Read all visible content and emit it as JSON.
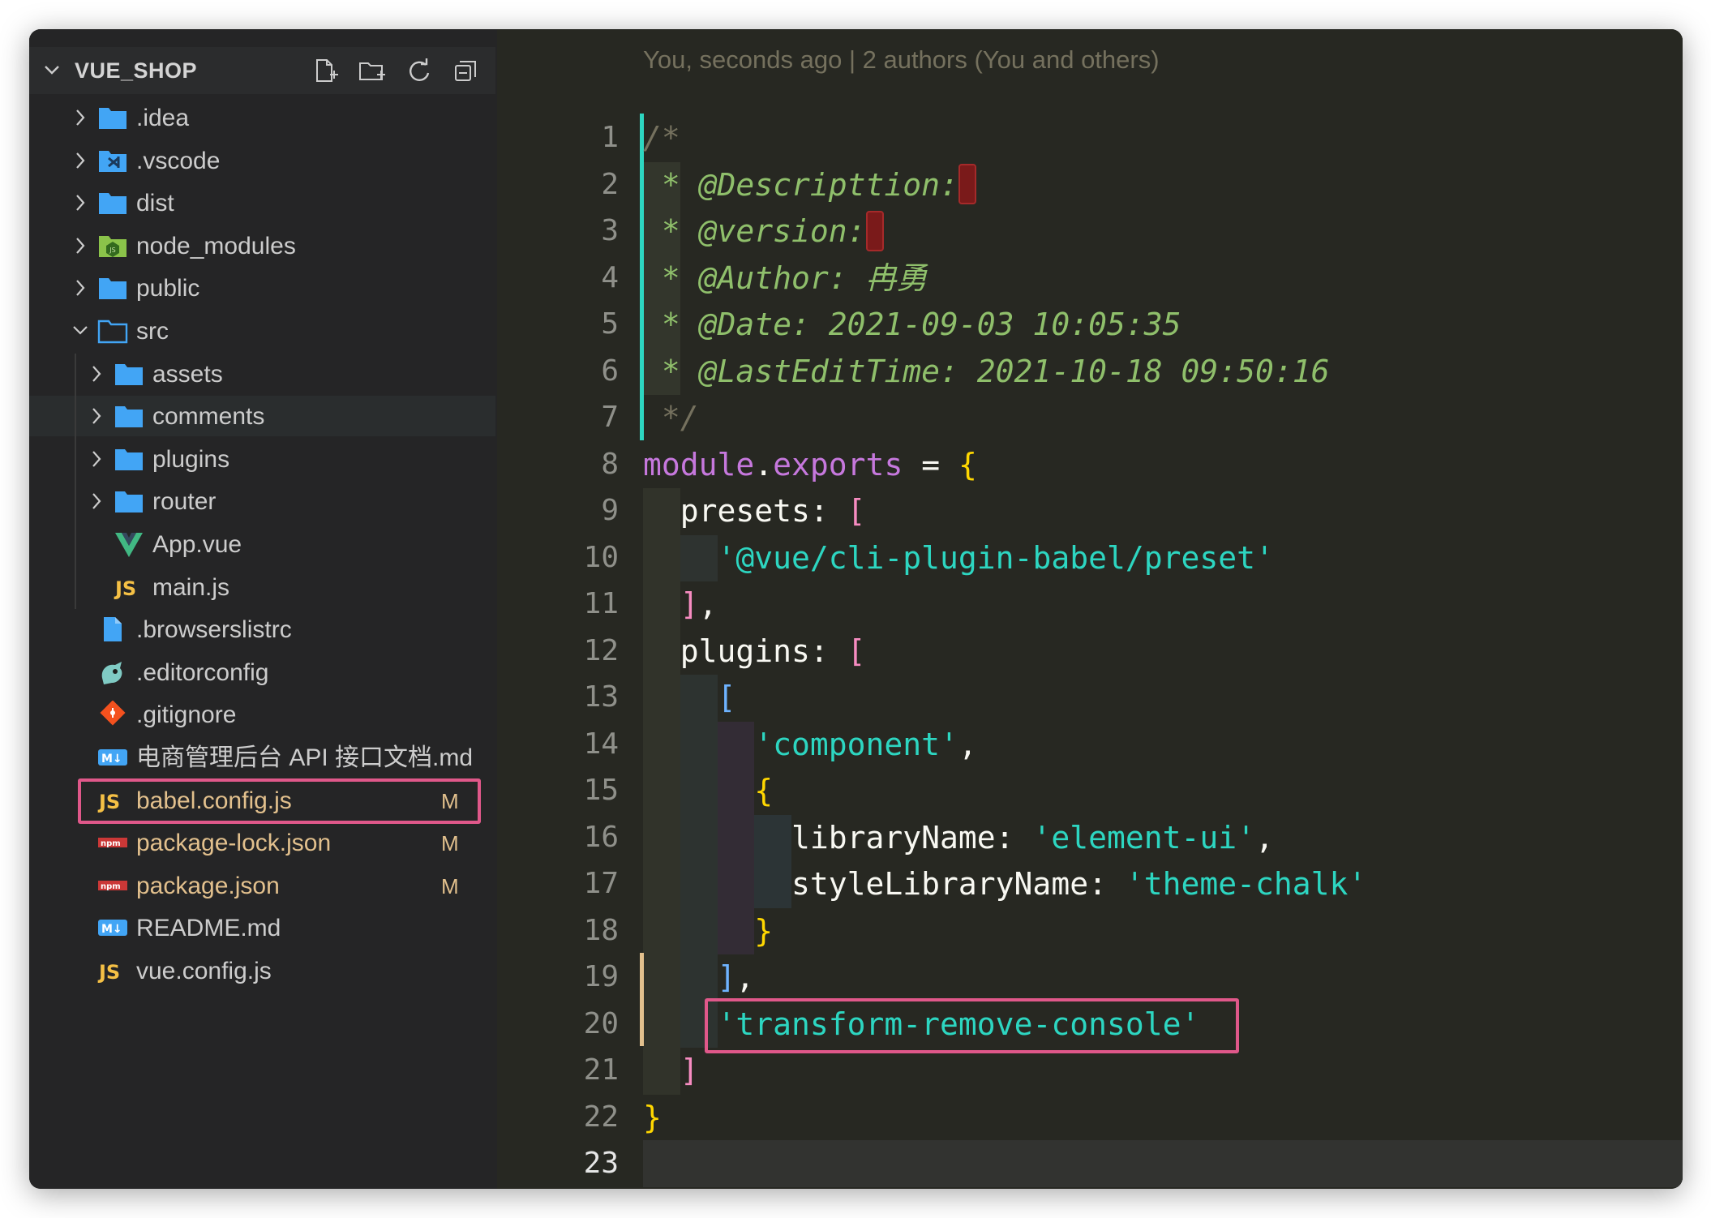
{
  "sidebar": {
    "project_name": "VUE_SHOP",
    "actions": [
      "new-file-icon",
      "new-folder-icon",
      "refresh-icon",
      "collapse-all-icon"
    ],
    "items": [
      {
        "label": ".idea",
        "type": "folder",
        "icon": "folder-icon",
        "depth": 0,
        "expanded": false
      },
      {
        "label": ".vscode",
        "type": "folder",
        "icon": "vscode-folder-icon",
        "depth": 0,
        "expanded": false
      },
      {
        "label": "dist",
        "type": "folder",
        "icon": "folder-icon",
        "depth": 0,
        "expanded": false
      },
      {
        "label": "node_modules",
        "type": "folder",
        "icon": "node-folder-icon",
        "depth": 0,
        "expanded": false
      },
      {
        "label": "public",
        "type": "folder",
        "icon": "folder-icon",
        "depth": 0,
        "expanded": false
      },
      {
        "label": "src",
        "type": "folder",
        "icon": "folder-open-icon",
        "depth": 0,
        "expanded": true
      },
      {
        "label": "assets",
        "type": "folder",
        "icon": "folder-icon",
        "depth": 1,
        "expanded": false
      },
      {
        "label": "comments",
        "type": "folder",
        "icon": "folder-icon",
        "depth": 1,
        "expanded": false,
        "hover": true
      },
      {
        "label": "plugins",
        "type": "folder",
        "icon": "folder-icon",
        "depth": 1,
        "expanded": false
      },
      {
        "label": "router",
        "type": "folder",
        "icon": "folder-icon",
        "depth": 1,
        "expanded": false
      },
      {
        "label": "App.vue",
        "type": "file",
        "icon": "vue-icon",
        "depth": 1
      },
      {
        "label": "main.js",
        "type": "file",
        "icon": "js-icon",
        "depth": 1
      },
      {
        "label": ".browserslistrc",
        "type": "file",
        "icon": "file-icon",
        "depth": 0
      },
      {
        "label": ".editorconfig",
        "type": "file",
        "icon": "editorconfig-icon",
        "depth": 0
      },
      {
        "label": ".gitignore",
        "type": "file",
        "icon": "git-icon",
        "depth": 0
      },
      {
        "label": "电商管理后台 API 接口文档.md",
        "type": "file",
        "icon": "markdown-icon",
        "depth": 0
      },
      {
        "label": "babel.config.js",
        "type": "file",
        "icon": "js-icon",
        "depth": 0,
        "badge": "M",
        "highlighted": true
      },
      {
        "label": "package-lock.json",
        "type": "file",
        "icon": "npm-icon",
        "depth": 0,
        "badge": "M"
      },
      {
        "label": "package.json",
        "type": "file",
        "icon": "npm-icon",
        "depth": 0,
        "badge": "M"
      },
      {
        "label": "README.md",
        "type": "file",
        "icon": "markdown-icon",
        "depth": 0
      },
      {
        "label": "vue.config.js",
        "type": "file",
        "icon": "js-icon",
        "depth": 0
      }
    ]
  },
  "editor": {
    "blame": "You, seconds ago | 2 authors (You and others)",
    "active_line": 23,
    "line_numbers": [
      "1",
      "2",
      "3",
      "4",
      "5",
      "6",
      "7",
      "8",
      "9",
      "10",
      "11",
      "12",
      "13",
      "14",
      "15",
      "16",
      "17",
      "18",
      "19",
      "20",
      "21",
      "22",
      "23"
    ],
    "lines": [
      {
        "tokens": [
          {
            "t": "/*",
            "c": "c-gray"
          }
        ]
      },
      {
        "tokens": [
          {
            "t": " * @Descripttion:",
            "c": "c-com"
          }
        ],
        "error": true
      },
      {
        "tokens": [
          {
            "t": " * @version:",
            "c": "c-com"
          }
        ],
        "error": true
      },
      {
        "tokens": [
          {
            "t": " * @Author: 冉勇",
            "c": "c-com"
          }
        ]
      },
      {
        "tokens": [
          {
            "t": " * @Date: 2021-09-03 10:05:35",
            "c": "c-com"
          }
        ]
      },
      {
        "tokens": [
          {
            "t": " * @LastEditTime: 2021-10-18 09:50:16",
            "c": "c-com"
          }
        ]
      },
      {
        "tokens": [
          {
            "t": " */",
            "c": "c-gray"
          }
        ]
      },
      {
        "tokens": [
          {
            "t": "module",
            "c": "c-purple"
          },
          {
            "t": ".",
            "c": "c-white"
          },
          {
            "t": "exports",
            "c": "c-purple"
          },
          {
            "t": " = ",
            "c": "c-white"
          },
          {
            "t": "{",
            "c": "c-yellow"
          }
        ]
      },
      {
        "tokens": [
          {
            "t": "  presets: ",
            "c": "c-white"
          },
          {
            "t": "[",
            "c": "c-pink"
          }
        ]
      },
      {
        "tokens": [
          {
            "t": "    ",
            "c": "c-white"
          },
          {
            "t": "'@vue/cli-plugin-babel/preset'",
            "c": "c-str"
          }
        ]
      },
      {
        "tokens": [
          {
            "t": "  ",
            "c": "c-white"
          },
          {
            "t": "]",
            "c": "c-pink"
          },
          {
            "t": ",",
            "c": "c-white"
          }
        ]
      },
      {
        "tokens": [
          {
            "t": "  plugins: ",
            "c": "c-white"
          },
          {
            "t": "[",
            "c": "c-pink"
          }
        ]
      },
      {
        "tokens": [
          {
            "t": "    ",
            "c": "c-white"
          },
          {
            "t": "[",
            "c": "c-blue"
          }
        ]
      },
      {
        "tokens": [
          {
            "t": "      ",
            "c": "c-white"
          },
          {
            "t": "'component'",
            "c": "c-str"
          },
          {
            "t": ",",
            "c": "c-white"
          }
        ]
      },
      {
        "tokens": [
          {
            "t": "      ",
            "c": "c-white"
          },
          {
            "t": "{",
            "c": "c-yellow"
          }
        ]
      },
      {
        "tokens": [
          {
            "t": "        libraryName: ",
            "c": "c-white"
          },
          {
            "t": "'element-ui'",
            "c": "c-str"
          },
          {
            "t": ",",
            "c": "c-white"
          }
        ]
      },
      {
        "tokens": [
          {
            "t": "        styleLibraryName: ",
            "c": "c-white"
          },
          {
            "t": "'theme-chalk'",
            "c": "c-str"
          }
        ]
      },
      {
        "tokens": [
          {
            "t": "      ",
            "c": "c-white"
          },
          {
            "t": "}",
            "c": "c-yellow"
          }
        ]
      },
      {
        "tokens": [
          {
            "t": "    ",
            "c": "c-white"
          },
          {
            "t": "]",
            "c": "c-blue"
          },
          {
            "t": ",",
            "c": "c-white"
          }
        ]
      },
      {
        "tokens": [
          {
            "t": "    ",
            "c": "c-white"
          },
          {
            "t": "'transform-remove-console'",
            "c": "c-str"
          }
        ],
        "highlighted": true
      },
      {
        "tokens": [
          {
            "t": "  ",
            "c": "c-white"
          },
          {
            "t": "]",
            "c": "c-pink"
          }
        ]
      },
      {
        "tokens": [
          {
            "t": "}",
            "c": "c-yellow"
          }
        ]
      },
      {
        "tokens": []
      }
    ]
  },
  "colors": {
    "highlight_box": "#e0588a",
    "git_added": "#2dd6c1",
    "git_modified": "#e2c08d",
    "folder_blue": "#42a5f5"
  }
}
